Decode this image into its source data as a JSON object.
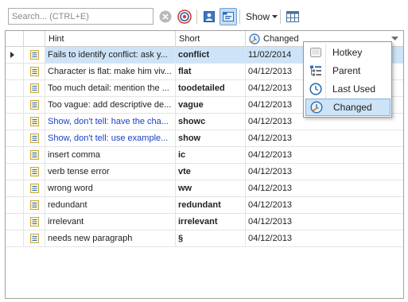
{
  "toolbar": {
    "search_placeholder": "Search... (CTRL+E)",
    "show_label": "Show"
  },
  "columns": {
    "hint": "Hint",
    "short": "Short",
    "changed": "Changed"
  },
  "rows": [
    {
      "hint": "Fails to identify conflict: ask y...",
      "short": "conflict",
      "changed": "11/02/2014"
    },
    {
      "hint": "Character is flat: make him viv...",
      "short": "flat",
      "changed": "04/12/2013"
    },
    {
      "hint": "Too much detail: mention the ...",
      "short": "toodetailed",
      "changed": "04/12/2013"
    },
    {
      "hint": "Too vague: add descriptive de...",
      "short": "vague",
      "changed": "04/12/2013"
    },
    {
      "hint": "Show, don't tell: have the cha...",
      "short": "showc",
      "changed": "04/12/2013"
    },
    {
      "hint": "Show, don't tell: use example...",
      "short": "show",
      "changed": "04/12/2013"
    },
    {
      "hint": "insert comma",
      "short": "ic",
      "changed": "04/12/2013"
    },
    {
      "hint": "verb tense error",
      "short": "vte",
      "changed": "04/12/2013"
    },
    {
      "hint": "wrong word",
      "short": "ww",
      "changed": "04/12/2013"
    },
    {
      "hint": "redundant",
      "short": "redundant",
      "changed": "04/12/2013"
    },
    {
      "hint": "irrelevant",
      "short": "irrelevant",
      "changed": "04/12/2013"
    },
    {
      "hint": "needs new paragraph",
      "short": "§",
      "changed": "04/12/2013"
    }
  ],
  "menu": {
    "items": [
      {
        "label": "Hotkey",
        "icon": "keyboard-key-icon"
      },
      {
        "label": "Parent",
        "icon": "tree-list-icon"
      },
      {
        "label": "Last Used",
        "icon": "clock-icon"
      },
      {
        "label": "Changed",
        "icon": "edit-clock-icon",
        "selected": true
      }
    ]
  },
  "colors": {
    "selection": "#cde3f7",
    "link_blue": "#1a3fc4",
    "accent": "#2d7ccf"
  }
}
